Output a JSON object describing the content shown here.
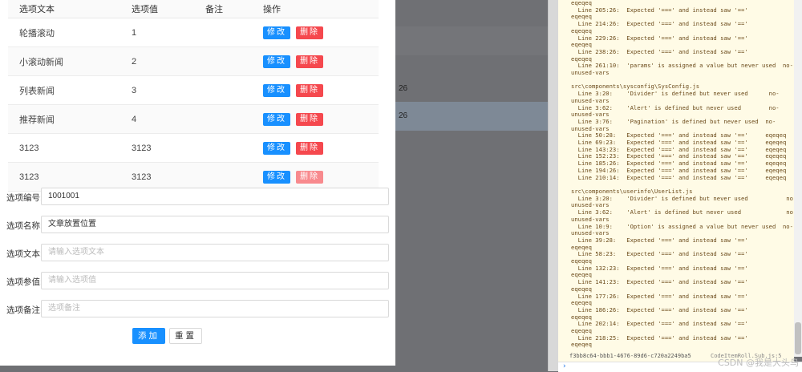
{
  "table": {
    "headers": [
      "选项文本",
      "选项值",
      "备注",
      "操作"
    ],
    "rows": [
      {
        "text": "轮播滚动",
        "value": "1",
        "note": ""
      },
      {
        "text": "小滚动新闻",
        "value": "2",
        "note": ""
      },
      {
        "text": "列表新闻",
        "value": "3",
        "note": ""
      },
      {
        "text": "推荐新闻",
        "value": "4",
        "note": ""
      },
      {
        "text": "3123",
        "value": "3123",
        "note": ""
      },
      {
        "text": "3123",
        "value": "3123",
        "note": ""
      }
    ],
    "edit_label": "修改",
    "delete_label": "删除"
  },
  "form": {
    "fields": [
      {
        "label": "选项编号:",
        "value": "1001001",
        "placeholder": ""
      },
      {
        "label": "选项名称:",
        "value": "文章放置位置",
        "placeholder": ""
      },
      {
        "label": "选项文本:",
        "value": "",
        "placeholder": "请输入选项文本"
      },
      {
        "label": "选项参值:",
        "value": "",
        "placeholder": "请输入选项值"
      },
      {
        "label": "选项备注:",
        "value": "",
        "placeholder": "选项备注"
      }
    ],
    "add_label": "添加",
    "reset_label": "重置"
  },
  "background": {
    "row_fragment_1": "26",
    "row_fragment_2": "26"
  },
  "console": {
    "lines": [
      "eqeqeq",
      "  Line 205:26:  Expected '===' and instead saw '=='",
      "eqeqeq",
      "  Line 214:26:  Expected '===' and instead saw '=='",
      "eqeqeq",
      "  Line 229:26:  Expected '===' and instead saw '=='",
      "eqeqeq",
      "  Line 238:26:  Expected '===' and instead saw '=='",
      "eqeqeq",
      "  Line 261:10:  'params' is assigned a value but never used  no-",
      "unused-vars",
      "",
      "src\\components\\sysconfig\\SysConfig.js",
      "  Line 3:20:    'Divider' is defined but never used      no-",
      "unused-vars",
      "  Line 3:62:    'Alert' is defined but never used        no-",
      "unused-vars",
      "  Line 3:76:    'Pagination' is defined but never used  no-",
      "unused-vars",
      "  Line 50:28:   Expected '===' and instead saw '=='     eqeqeq",
      "  Line 69:23:   Expected '===' and instead saw '=='     eqeqeq",
      "  Line 143:23:  Expected '===' and instead saw '=='     eqeqeq",
      "  Line 152:23:  Expected '===' and instead saw '=='     eqeqeq",
      "  Line 185:26:  Expected '===' and instead saw '=='     eqeqeq",
      "  Line 194:26:  Expected '===' and instead saw '=='     eqeqeq",
      "  Line 210:14:  Expected '===' and instead saw '=='     eqeqeq",
      "",
      "src\\components\\userinfo\\UserList.js",
      "  Line 3:20:    'Divider' is defined but never used           no-",
      "unused-vars",
      "  Line 3:62:    'Alert' is defined but never used             no-",
      "unused-vars",
      "  Line 10:9:    'Option' is assigned a value but never used  no-",
      "unused-vars",
      "  Line 39:28:   Expected '===' and instead saw '=='",
      "eqeqeq",
      "  Line 58:23:   Expected '===' and instead saw '=='",
      "eqeqeq",
      "  Line 132:23:  Expected '===' and instead saw '=='",
      "eqeqeq",
      "  Line 141:23:  Expected '===' and instead saw '=='",
      "eqeqeq",
      "  Line 177:26:  Expected '===' and instead saw '=='",
      "eqeqeq",
      "  Line 186:26:  Expected '===' and instead saw '=='",
      "eqeqeq",
      "  Line 202:14:  Expected '===' and instead saw '=='",
      "eqeqeq",
      "  Line 218:25:  Expected '===' and instead saw '=='",
      "eqeqeq"
    ],
    "status_uuid": "f3bb8c64-bbb1-4676-89d6-c720a2249ba5",
    "status_source": "CodeItemRoll.Sub.js:5"
  },
  "watermark": "CSDN @我是大头鸟"
}
